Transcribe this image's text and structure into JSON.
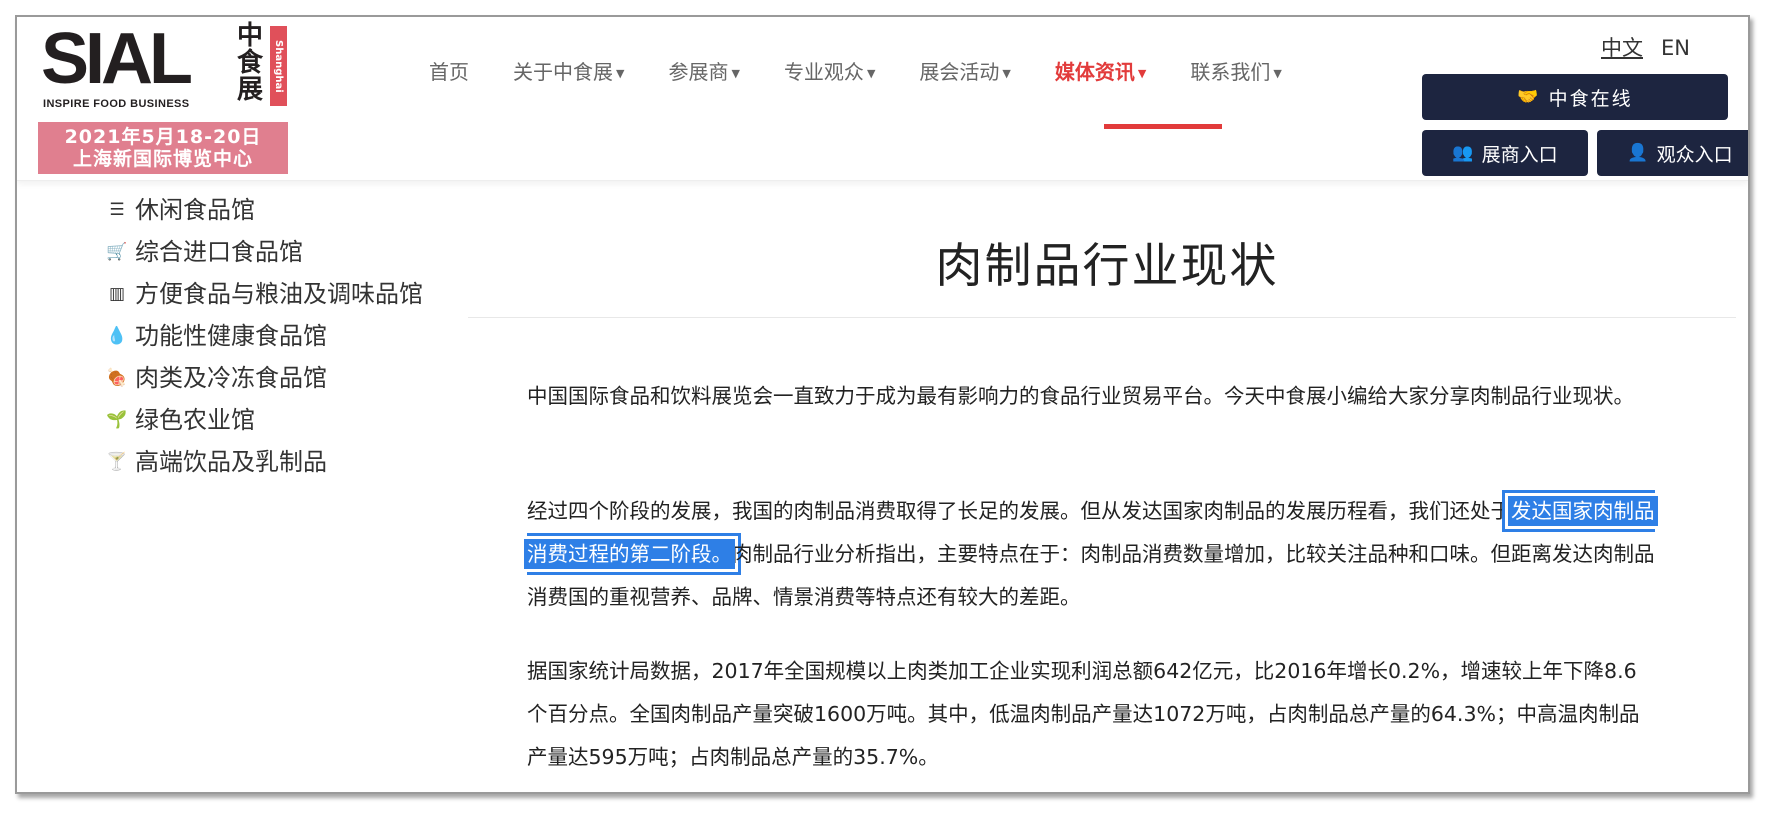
{
  "header": {
    "logo": {
      "brand": "SIAL",
      "tagline": "INSPIRE FOOD BUSINESS",
      "cn_name": "中食展",
      "city": "Shanghai",
      "date": "2021年5月18-20日",
      "venue": "上海新国际博览中心"
    },
    "nav": [
      {
        "label": "首页",
        "dropdown": false
      },
      {
        "label": "关于中食展",
        "dropdown": true
      },
      {
        "label": "参展商",
        "dropdown": true
      },
      {
        "label": "专业观众",
        "dropdown": true
      },
      {
        "label": "展会活动",
        "dropdown": true
      },
      {
        "label": "媒体资讯",
        "dropdown": true,
        "active": true
      },
      {
        "label": "联系我们",
        "dropdown": true
      }
    ],
    "lang": {
      "cn": "中文",
      "en": "EN"
    },
    "online_button": "中食在线",
    "exhibitor_button": "展商入口",
    "visitor_button": "观众入口",
    "accent_color": "#e23b3b",
    "button_color": "#1d2540"
  },
  "sidebar": {
    "items": [
      {
        "icon": "burger-icon",
        "label": "休闲食品馆"
      },
      {
        "icon": "cart-icon",
        "label": "综合进口食品馆"
      },
      {
        "icon": "bottles-icon",
        "label": "方便食品与粮油及调味品馆"
      },
      {
        "icon": "drop-icon",
        "label": "功能性健康食品馆"
      },
      {
        "icon": "meat-icon",
        "label": "肉类及冷冻食品馆"
      },
      {
        "icon": "sprout-icon",
        "label": "绿色农业馆"
      },
      {
        "icon": "cocktail-icon",
        "label": "高端饮品及乳制品"
      }
    ]
  },
  "article": {
    "title": "肉制品行业现状",
    "p1": "中国国际食品和饮料展览会一直致力于成为最有影响力的食品行业贸易平台。今天中食展小编给大家分享肉制品行业现状。",
    "p2_before": "经过四个阶段的发展，我国的肉制品消费取得了长足的发展。但从发达国家肉制品的发展历程看，我们还处于",
    "p2_highlight": "发达国家肉制品消费过程的第二阶段。",
    "p2_after": "肉制品行业分析指出，主要特点在于：肉制品消费数量增加，比较关注品种和口味。但距离发达肉制品消费国的重视营养、品牌、情景消费等特点还有较大的差距。",
    "p3": "据国家统计局数据，2017年全国规模以上肉类加工企业实现利润总额642亿元，比2016年增长0.2%，增速较上年下降8.6个百分点。全国肉制品产量突破1600万吨。其中，低温肉制品产量达1072万吨，占肉制品总产量的64.3%；中高温肉制品产量达595万吨；占肉制品总产量的35.7%。",
    "highlight_color": "#2e7fe6"
  }
}
